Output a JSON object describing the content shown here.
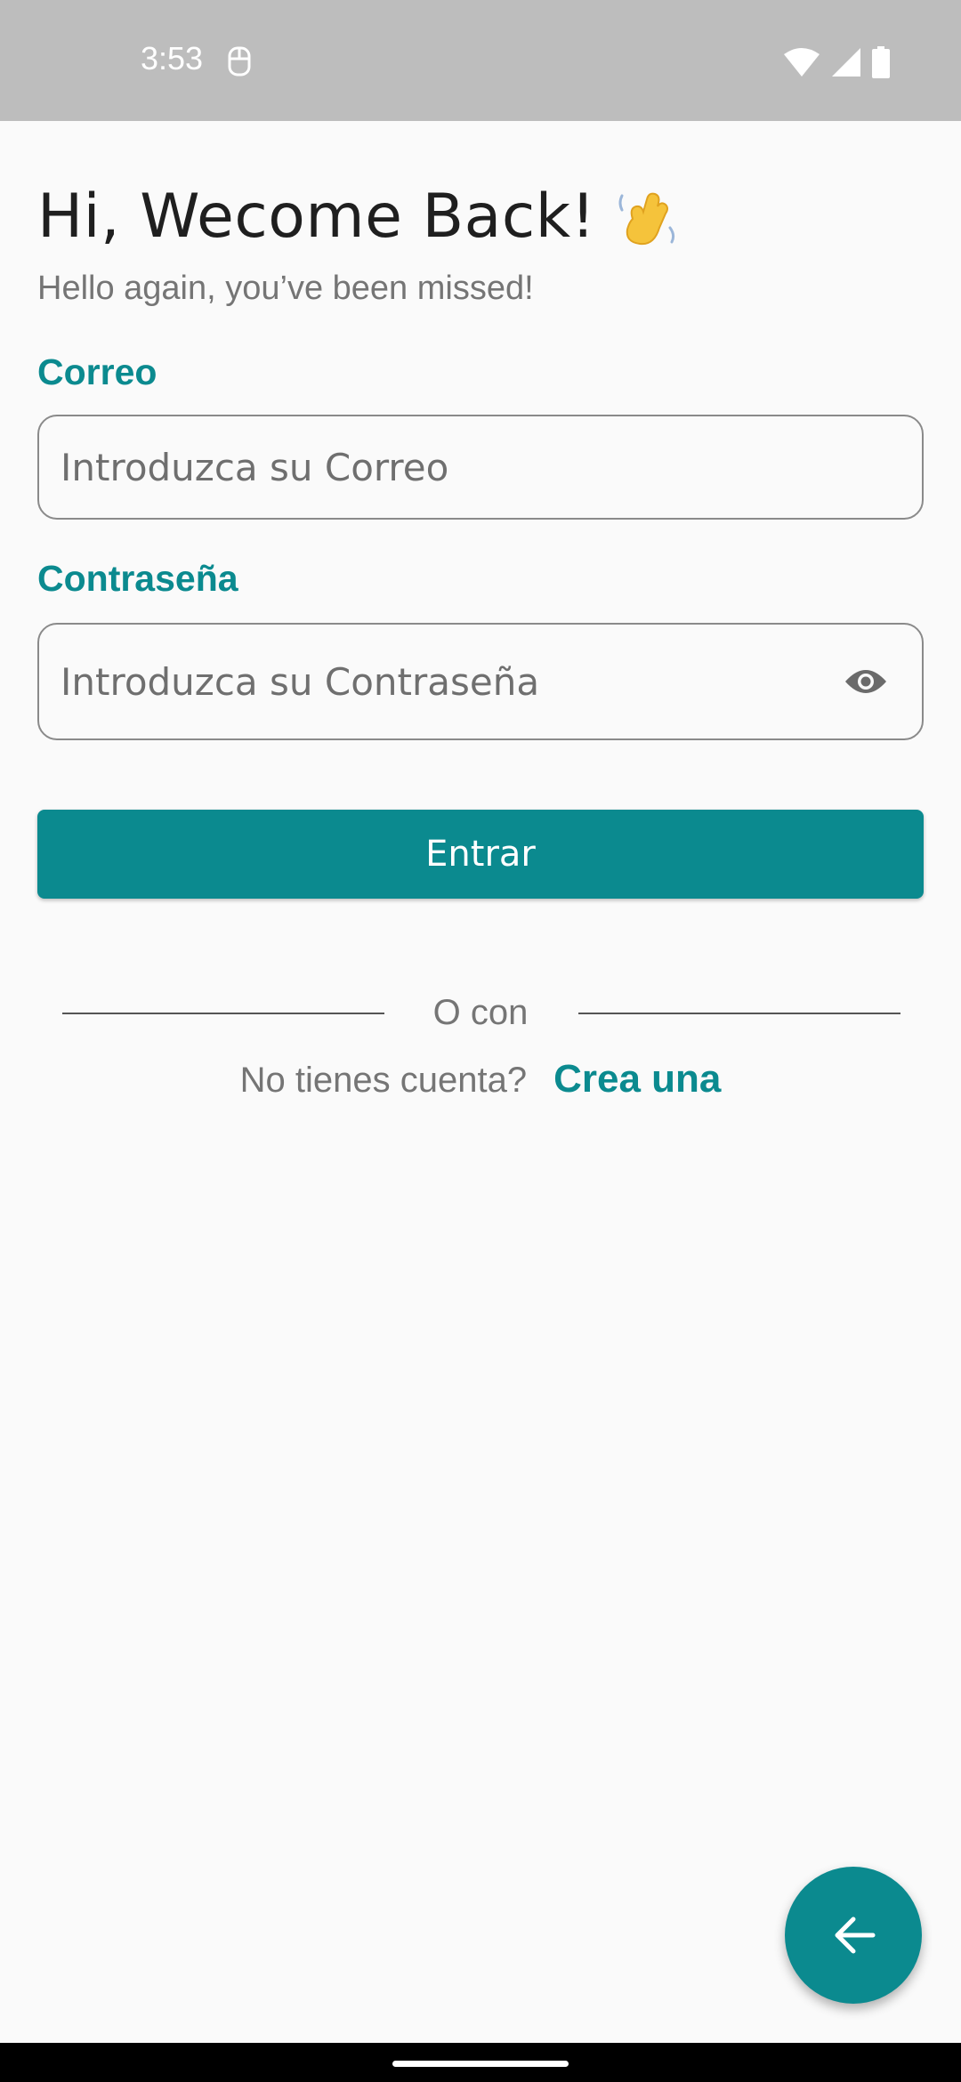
{
  "status_bar": {
    "time": "3:53",
    "icons": [
      "app-notification-icon",
      "wifi-icon",
      "signal-icon",
      "battery-icon"
    ]
  },
  "header": {
    "title": "Hi, Wecome Back!",
    "title_emoji_icon": "waving-hand-icon",
    "subtitle": "Hello again, you’ve been missed!"
  },
  "form": {
    "email": {
      "label": "Correo",
      "placeholder": "Introduzca su Correo",
      "value": ""
    },
    "password": {
      "label": "Contraseña",
      "placeholder": "Introduzca su Contraseña",
      "value": "",
      "toggle_icon": "eye-icon"
    },
    "submit_label": "Entrar"
  },
  "divider": {
    "text": "O con"
  },
  "signup": {
    "prompt": "No tienes cuenta?",
    "link": "Crea una"
  },
  "fab": {
    "icon": "arrow-back-icon"
  },
  "colors": {
    "accent": "#0b8a8f",
    "status_bar": "#bdbdbd",
    "background": "#fafafa"
  }
}
